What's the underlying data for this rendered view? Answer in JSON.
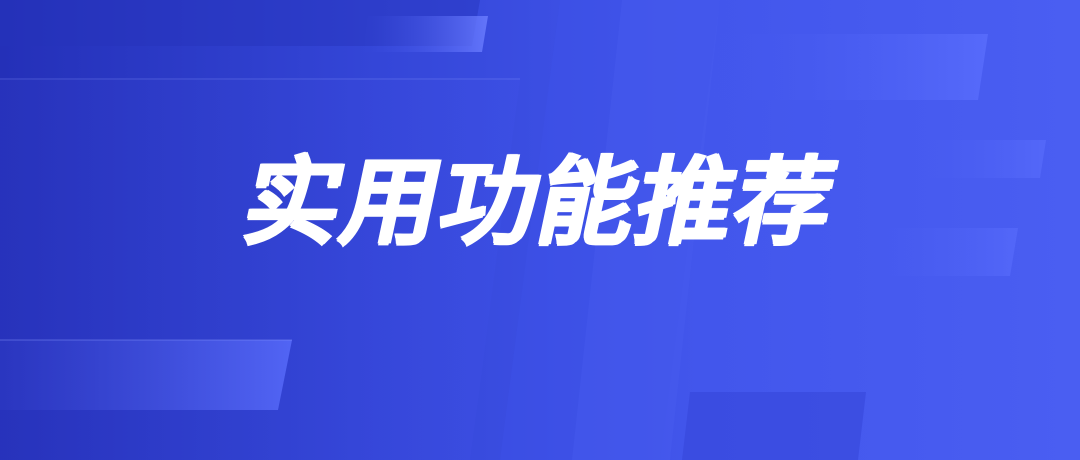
{
  "banner": {
    "title": "实用功能推荐"
  },
  "colors": {
    "background_dark": "#2430b8",
    "background_light": "#4a5ef2",
    "panel_accent": "#5a70ff",
    "title_color": "#ffffff"
  }
}
